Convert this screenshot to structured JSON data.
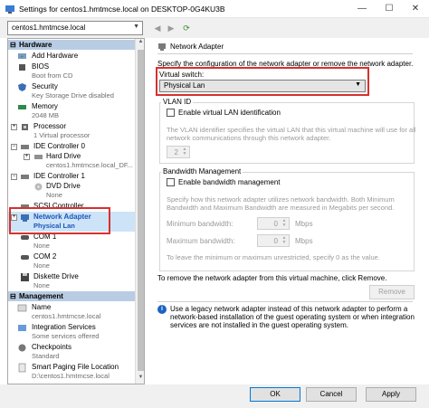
{
  "window": {
    "title": "Settings for centos1.hmtmcse.local on DESKTOP-0G4KU3B",
    "minimize": "—",
    "maximize": "☐",
    "close": "✕"
  },
  "vm_selector": {
    "value": "centos1.hmtmcse.local"
  },
  "sidebar": {
    "hardware_header": "Hardware",
    "management_header": "Management",
    "hardware_items": [
      {
        "label": "Add Hardware",
        "sub": ""
      },
      {
        "label": "BIOS",
        "sub": "Boot from CD"
      },
      {
        "label": "Security",
        "sub": "Key Storage Drive disabled"
      },
      {
        "label": "Memory",
        "sub": "2048 MB"
      },
      {
        "label": "Processor",
        "sub": "1 Virtual processor"
      },
      {
        "label": "IDE Controller 0",
        "sub": ""
      },
      {
        "label": "Hard Drive",
        "sub": "centos1.hmtmcse.local_DF..."
      },
      {
        "label": "IDE Controller 1",
        "sub": ""
      },
      {
        "label": "DVD Drive",
        "sub": "None"
      },
      {
        "label": "SCSI Controller",
        "sub": ""
      },
      {
        "label": "Network Adapter",
        "sub": "Physical Lan"
      },
      {
        "label": "COM 1",
        "sub": "None"
      },
      {
        "label": "COM 2",
        "sub": "None"
      },
      {
        "label": "Diskette Drive",
        "sub": "None"
      }
    ],
    "management_items": [
      {
        "label": "Name",
        "sub": "centos1.hmtmcse.local"
      },
      {
        "label": "Integration Services",
        "sub": "Some services offered"
      },
      {
        "label": "Checkpoints",
        "sub": "Standard"
      },
      {
        "label": "Smart Paging File Location",
        "sub": "D:\\centos1.hmtmcse.local"
      }
    ]
  },
  "panel": {
    "header": "Network Adapter",
    "description": "Specify the configuration of the network adapter or remove the network adapter.",
    "virtual_switch_label": "Virtual switch:",
    "virtual_switch_value": "Physical Lan",
    "vlan_group": "VLAN ID",
    "vlan_checkbox": "Enable virtual LAN identification",
    "vlan_desc_1": "The VLAN identifier specifies the virtual LAN that this virtual machine will use for all",
    "vlan_desc_2": "network communications through this network adapter.",
    "vlan_value": "2",
    "bw_group": "Bandwidth Management",
    "bw_checkbox": "Enable bandwidth management",
    "bw_desc_1": "Specify how this network adapter utilizes network bandwidth. Both Minimum",
    "bw_desc_2": "Bandwidth and Maximum Bandwidth are measured in Megabits per second.",
    "min_bw_label": "Minimum bandwidth:",
    "min_bw_value": "0",
    "max_bw_label": "Maximum bandwidth:",
    "max_bw_value": "0",
    "unit": "Mbps",
    "bw_hint": "To leave the minimum or maximum unrestricted, specify 0 as the value.",
    "remove_text": "To remove the network adapter from this virtual machine, click Remove.",
    "remove_button": "Remove",
    "info_1": "Use a legacy network adapter instead of this network adapter to perform a",
    "info_2": "network-based installation of the guest operating system or when integration",
    "info_3": "services are not installed in the guest operating system."
  },
  "footer": {
    "ok": "OK",
    "cancel": "Cancel",
    "apply": "Apply"
  },
  "colors": {
    "highlight": "#d6312e",
    "selection": "#cde3f7",
    "section": "#b8cde4"
  }
}
